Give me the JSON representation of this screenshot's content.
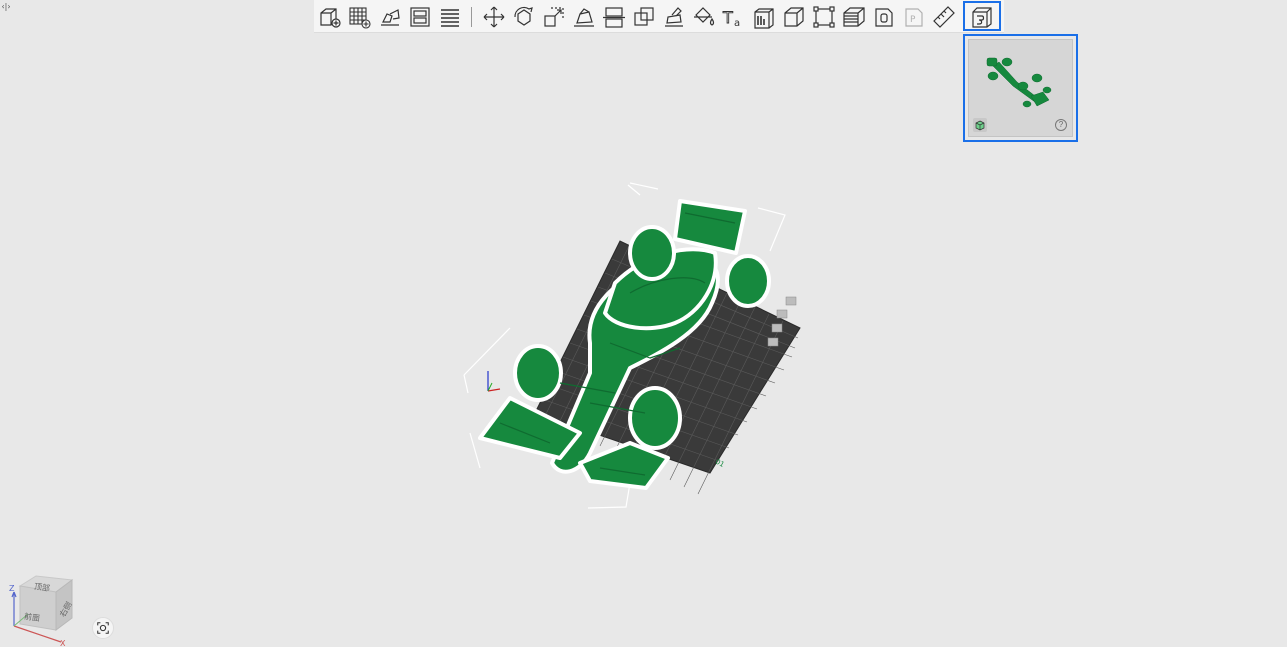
{
  "toggle": {
    "icon": "‹|›"
  },
  "toolbar": {
    "tools": [
      {
        "name": "add-object-icon"
      },
      {
        "name": "add-plate-icon"
      },
      {
        "name": "auto-arrange-icon"
      },
      {
        "name": "plate-layout-icon"
      },
      {
        "name": "layers-list-icon"
      },
      {
        "name": "move-icon"
      },
      {
        "name": "rotate-icon"
      },
      {
        "name": "scale-icon"
      },
      {
        "name": "lay-on-face-icon"
      },
      {
        "name": "cut-icon"
      },
      {
        "name": "boolean-icon"
      },
      {
        "name": "support-paint-icon"
      },
      {
        "name": "color-paint-icon"
      },
      {
        "name": "text-icon",
        "text": "Ta"
      },
      {
        "name": "emboss-icon"
      },
      {
        "name": "hollow-icon"
      },
      {
        "name": "bounding-icon"
      },
      {
        "name": "variable-layer-icon"
      },
      {
        "name": "measure-box-icon"
      },
      {
        "name": "p-icon",
        "text": "P"
      },
      {
        "name": "ruler-icon"
      },
      {
        "name": "assembly-view-icon"
      }
    ]
  },
  "preview": {
    "help": "?"
  },
  "view_cube": {
    "top_label": "顶部",
    "front_label": "前面",
    "right_label": "右侧",
    "z_label": "Z",
    "x_label": "X"
  },
  "colors": {
    "accent": "#1a6fe8",
    "model": "#16893e",
    "model_dark": "#0f6b30",
    "bed": "#3a3a3a"
  }
}
